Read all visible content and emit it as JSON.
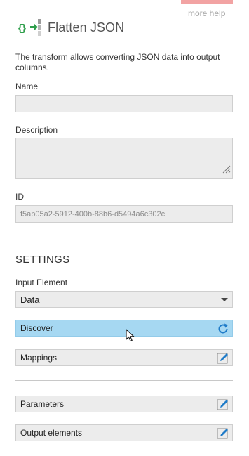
{
  "header": {
    "title": "Flatten JSON",
    "icon": "flatten-json-icon",
    "more_help": "more help",
    "accent": "#2e9e4b"
  },
  "description_text": "The transform allows converting JSON data into output columns.",
  "fields": {
    "name_label": "Name",
    "name_value": "",
    "description_label": "Description",
    "description_value": "",
    "id_label": "ID",
    "id_value": "f5ab05a2-5912-400b-88b6-d5494a6c302c"
  },
  "settings": {
    "heading": "SETTINGS",
    "input_element_label": "Input Element",
    "input_element_value": "Data"
  },
  "buttons": {
    "discover": "Discover",
    "mappings": "Mappings",
    "parameters": "Parameters",
    "output_elements": "Output elements"
  },
  "colors": {
    "discover_bg": "#a6d8f2",
    "icon_blue": "#1e7bc8",
    "top_tab": "#f2a3a3"
  }
}
